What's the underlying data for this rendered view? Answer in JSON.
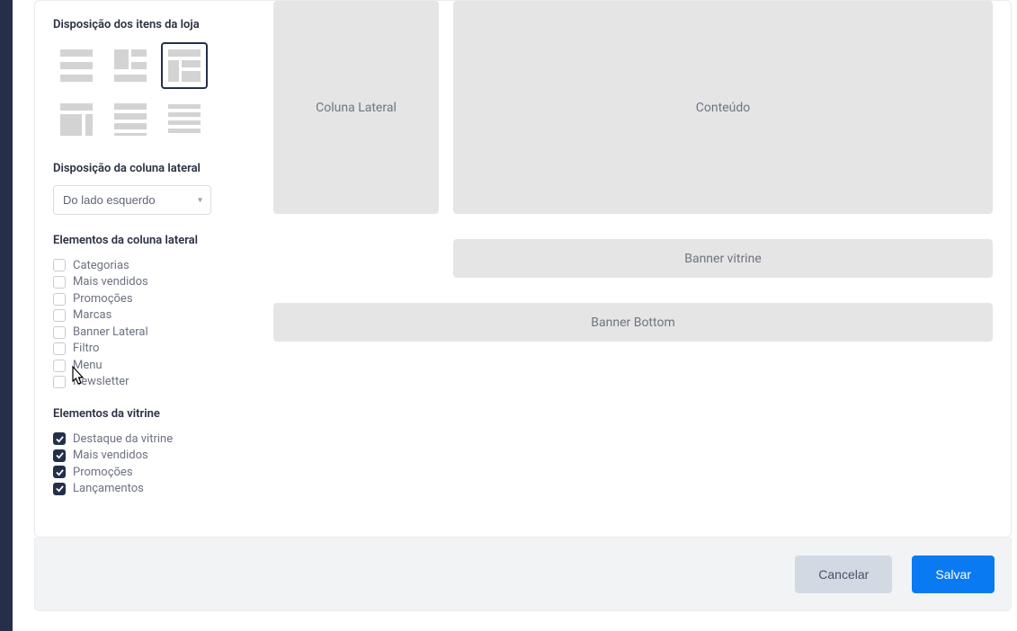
{
  "sections": {
    "layout_title": "Disposição dos itens da loja",
    "sidebar_pos_title": "Disposição da coluna lateral",
    "sidebar_elems_title": "Elementos da coluna lateral",
    "showcase_elems_title": "Elementos da vitrine"
  },
  "sidebar_position": {
    "selected": "Do lado esquerdo"
  },
  "sidebar_elements": [
    {
      "label": "Categorias",
      "checked": false
    },
    {
      "label": "Mais vendidos",
      "checked": false
    },
    {
      "label": "Promoções",
      "checked": false
    },
    {
      "label": "Marcas",
      "checked": false
    },
    {
      "label": "Banner Lateral",
      "checked": false
    },
    {
      "label": "Filtro",
      "checked": false
    },
    {
      "label": "Menu",
      "checked": false
    },
    {
      "label": "Newsletter",
      "checked": false
    }
  ],
  "showcase_elements": [
    {
      "label": "Destaque da vitrine",
      "checked": true
    },
    {
      "label": "Mais vendidos",
      "checked": true
    },
    {
      "label": "Promoções",
      "checked": true
    },
    {
      "label": "Lançamentos",
      "checked": true
    }
  ],
  "preview": {
    "side_col": "Coluna Lateral",
    "content_col": "Conteúdo",
    "banner_showcase": "Banner vitrine",
    "banner_bottom": "Banner Bottom"
  },
  "footer": {
    "cancel": "Cancelar",
    "save": "Salvar"
  },
  "layout_selected_index": 2
}
